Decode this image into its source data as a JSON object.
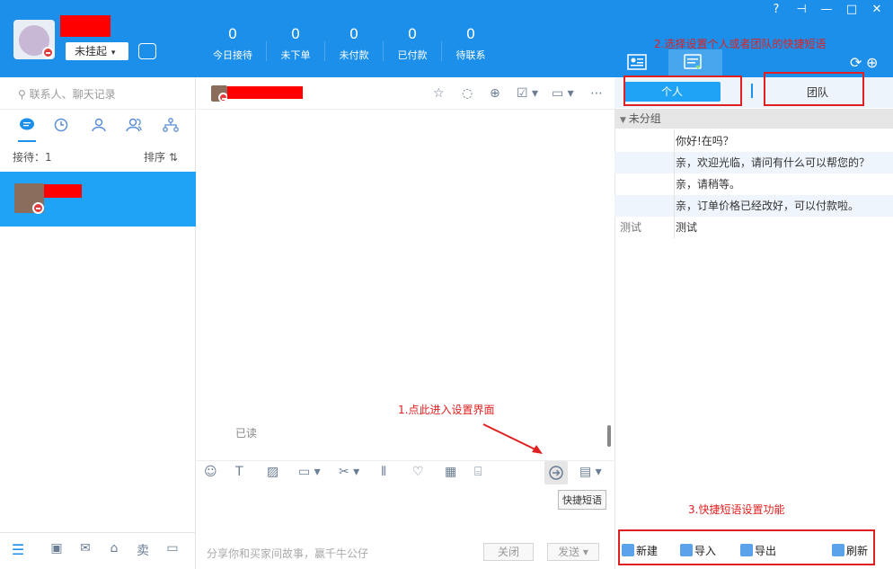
{
  "header": {
    "status_label": "未挂起",
    "stats": [
      {
        "value": "0",
        "label": "今日接待"
      },
      {
        "value": "0",
        "label": "未下单"
      },
      {
        "value": "0",
        "label": "未付款"
      },
      {
        "value": "0",
        "label": "已付款"
      },
      {
        "value": "0",
        "label": "待联系"
      }
    ],
    "window_controls": [
      "?",
      "⊣",
      "—",
      "□",
      "✕"
    ]
  },
  "annotations": {
    "step1": "1.点此进入设置界面",
    "step2": "2.选择设置个人或者团队的快捷短语",
    "step3": "3.快捷短语设置功能"
  },
  "left": {
    "search_placeholder": "联系人、聊天记录",
    "reception": "接待：1",
    "sort_label": "排序 ⇅",
    "bottom_icons": [
      "menu-icon",
      "app-icon",
      "mail-icon",
      "store-icon",
      "sell-icon",
      "window-icon"
    ],
    "bottom_sell": "卖"
  },
  "chat": {
    "read_label": "已读",
    "tooltip": "快捷短语",
    "input_hint": "分享你和买家间故事，赢千牛公仔",
    "close_label": "关闭",
    "send_label": "发送 ▾"
  },
  "right": {
    "tab_personal": "个人",
    "tab_team": "团队",
    "group_name": "未分组",
    "phrases": [
      {
        "key": "",
        "text": "你好!在吗？"
      },
      {
        "key": "",
        "text": "亲，欢迎光临，请问有什么可以帮您的？"
      },
      {
        "key": "",
        "text": "亲，请稍等。"
      },
      {
        "key": "",
        "text": "亲，订单价格已经改好，可以付款啦。"
      },
      {
        "key": "测试",
        "text": "测试"
      }
    ],
    "actions": {
      "new": "新建",
      "import": "导入",
      "export": "导出",
      "refresh": "刷新"
    }
  },
  "colors": {
    "brand": "#1b8fe9",
    "selected": "#1fa3f7",
    "annotation": "#e02020"
  }
}
